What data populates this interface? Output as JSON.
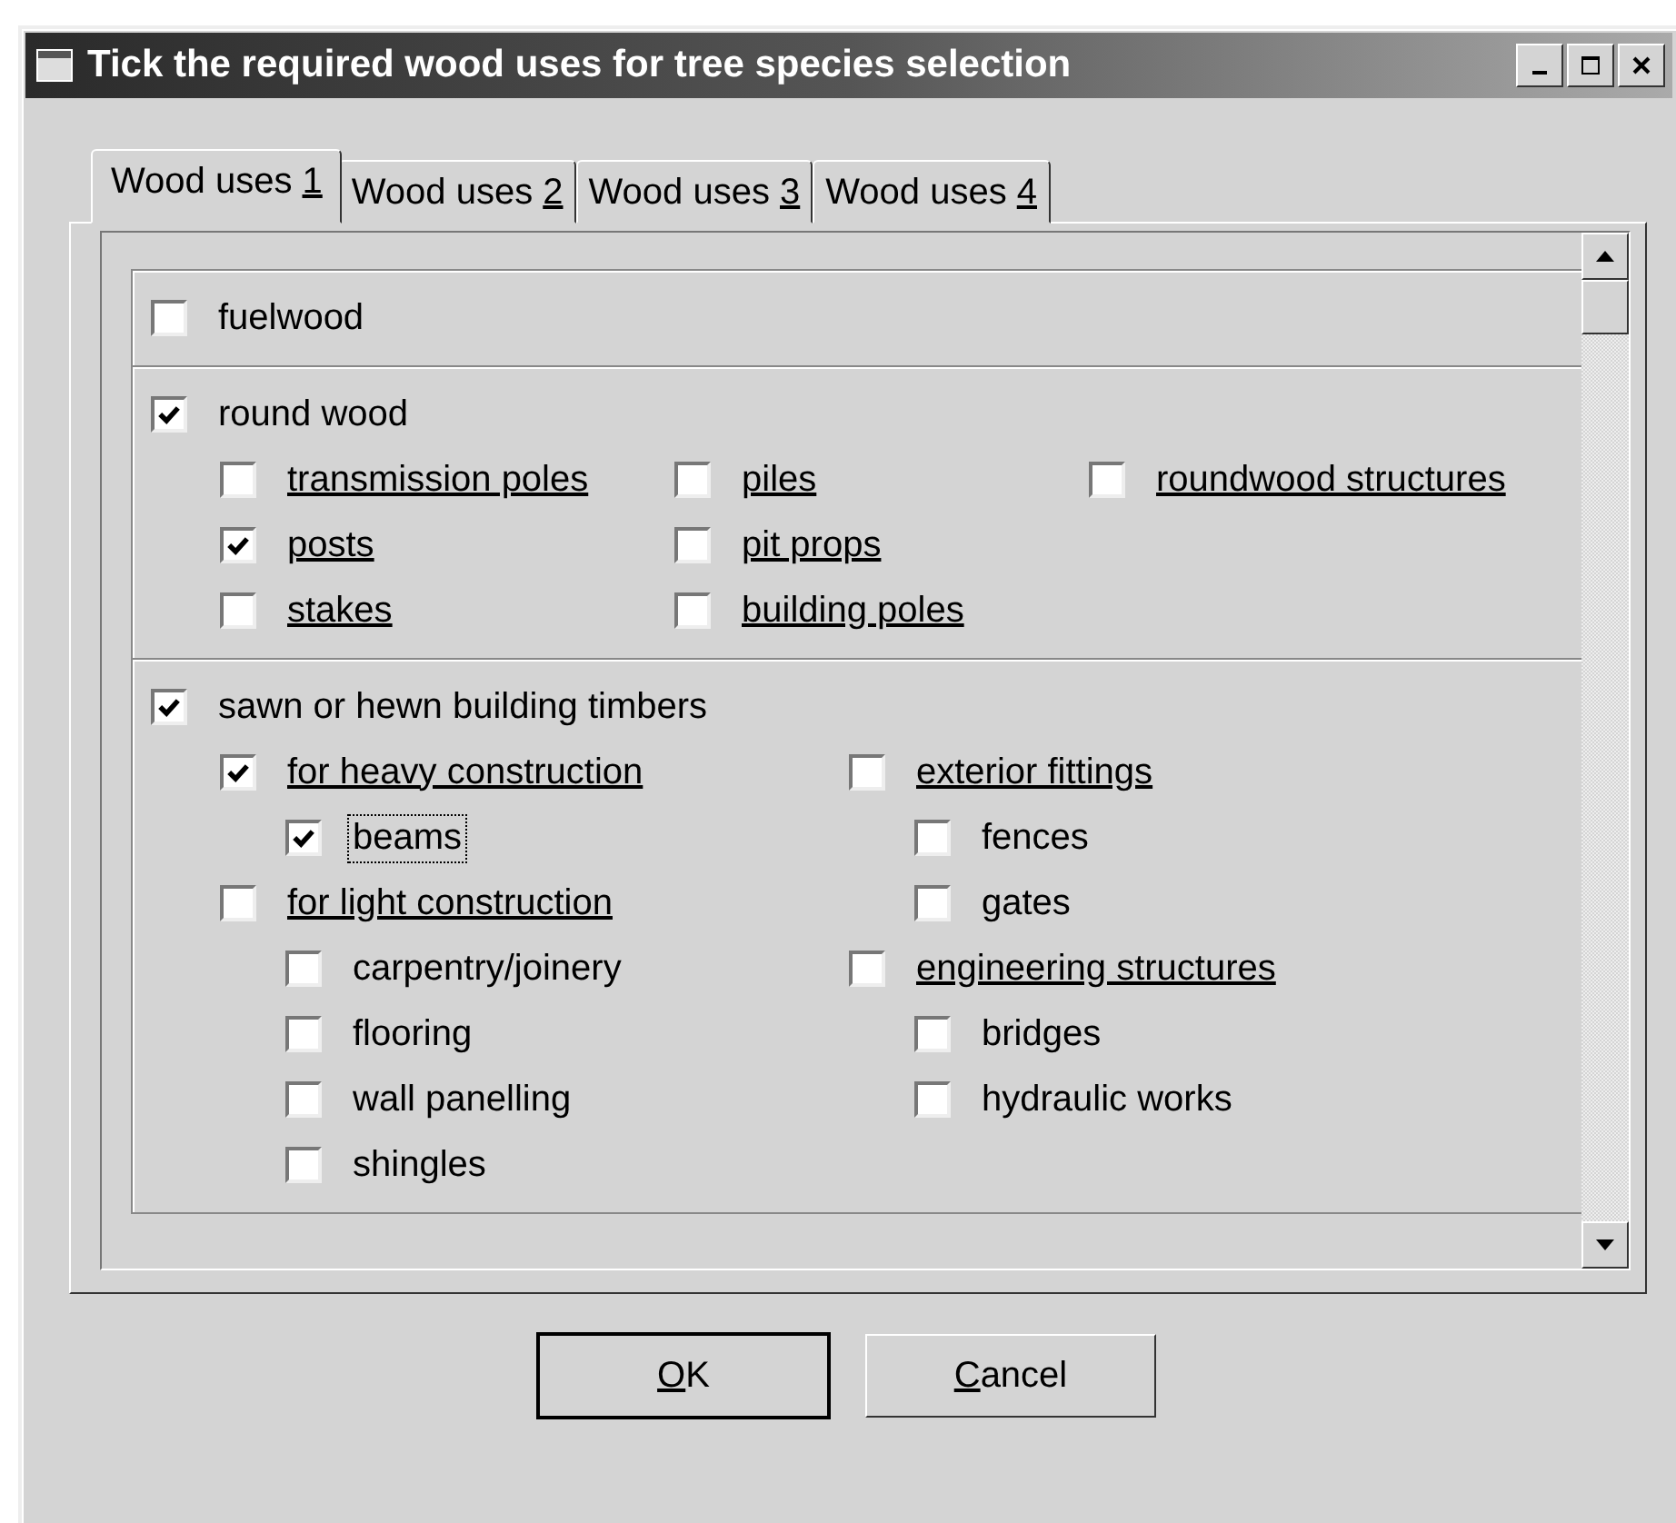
{
  "window": {
    "title": "Tick the required wood uses for tree species selection"
  },
  "tabs": [
    {
      "text": "Wood uses ",
      "key": "1",
      "selected": true
    },
    {
      "text": "Wood uses ",
      "key": "2",
      "selected": false
    },
    {
      "text": "Wood uses ",
      "key": "3",
      "selected": false
    },
    {
      "text": "Wood uses ",
      "key": "4",
      "selected": false
    }
  ],
  "sections": [
    {
      "label": "fuelwood",
      "checked": false
    },
    {
      "label": "round wood",
      "checked": true,
      "columns": [
        [
          {
            "label": "transmission poles",
            "kind": "link",
            "checked": false
          },
          {
            "label": "posts",
            "kind": "link",
            "checked": true
          },
          {
            "label": "stakes",
            "kind": "link",
            "checked": false
          }
        ],
        [
          {
            "label": "piles",
            "kind": "link",
            "checked": false
          },
          {
            "label": "pit props",
            "kind": "link",
            "checked": false
          },
          {
            "label": "building poles",
            "kind": "link",
            "checked": false
          }
        ],
        [
          {
            "label": "roundwood structures",
            "kind": "link",
            "checked": false
          }
        ]
      ]
    },
    {
      "label": "sawn or hewn building timbers",
      "checked": true,
      "columns": [
        [
          {
            "label": "for heavy construction",
            "kind": "link",
            "checked": true,
            "children": [
              {
                "label": "beams",
                "kind": "plain",
                "checked": true,
                "focused": true
              }
            ]
          },
          {
            "label": "for light construction",
            "kind": "link",
            "checked": false,
            "children": [
              {
                "label": "carpentry/joinery",
                "kind": "plain",
                "checked": false,
                "focused": false
              },
              {
                "label": "flooring",
                "kind": "plain",
                "checked": false,
                "focused": false
              },
              {
                "label": "wall panelling",
                "kind": "plain",
                "checked": false,
                "focused": false
              },
              {
                "label": "shingles",
                "kind": "plain",
                "checked": false,
                "focused": false
              }
            ]
          }
        ],
        [
          {
            "label": "exterior fittings",
            "kind": "link",
            "checked": false,
            "children": [
              {
                "label": "fences",
                "kind": "plain",
                "checked": false,
                "focused": false
              },
              {
                "label": "gates",
                "kind": "plain",
                "checked": false,
                "focused": false
              }
            ]
          },
          {
            "label": "engineering structures",
            "kind": "link",
            "checked": false,
            "children": [
              {
                "label": "bridges",
                "kind": "plain",
                "checked": false,
                "focused": false
              },
              {
                "label": "hydraulic works",
                "kind": "plain",
                "checked": false,
                "focused": false
              }
            ]
          }
        ]
      ]
    }
  ],
  "buttons": [
    {
      "key": "O",
      "rest": "K",
      "default": true
    },
    {
      "key": "C",
      "rest": "ancel",
      "default": false
    }
  ]
}
